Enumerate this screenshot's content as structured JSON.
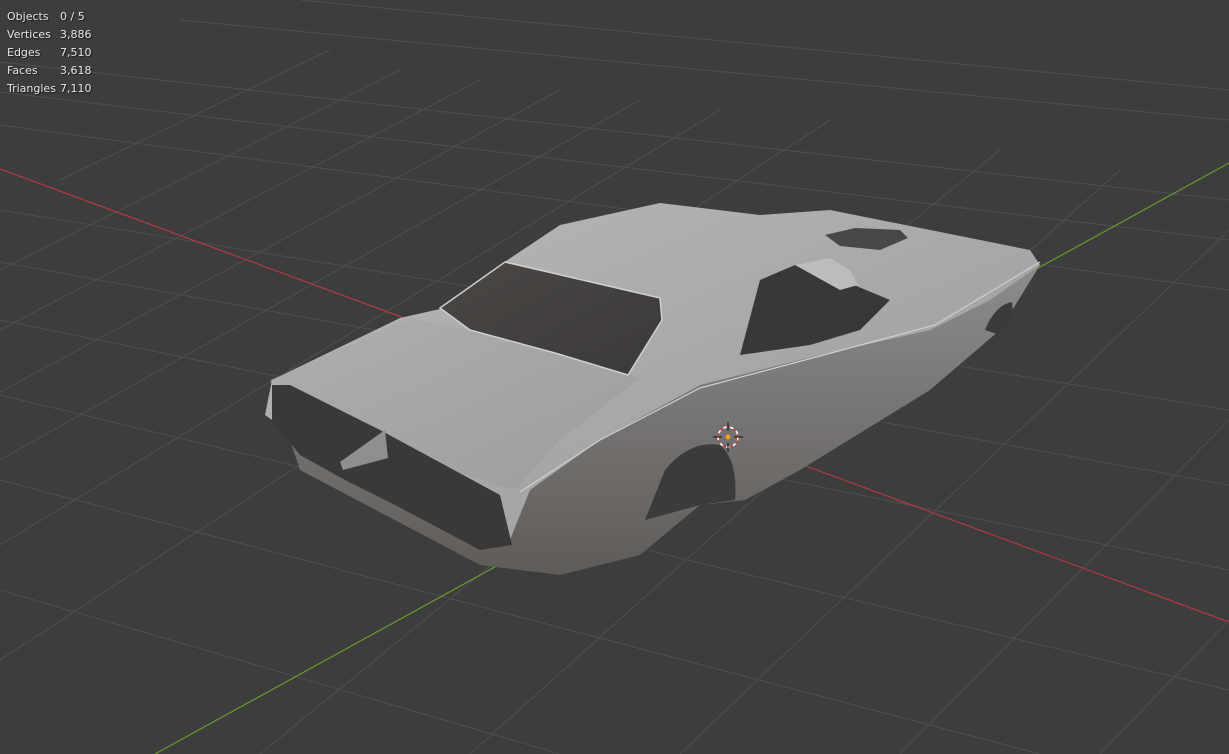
{
  "stats": [
    {
      "label": "Objects",
      "value": "0 / 5"
    },
    {
      "label": "Vertices",
      "value": "3,886"
    },
    {
      "label": "Edges",
      "value": "7,510"
    },
    {
      "label": "Faces",
      "value": "3,618"
    },
    {
      "label": "Triangles",
      "value": "7,110"
    }
  ],
  "colors": {
    "background": "#3d3d3d",
    "grid_line": "#4f4f4f",
    "x_axis": "#b03a44",
    "y_axis": "#6a9a2a",
    "model": "#a9a9a9",
    "cursor": "#d33a3a"
  },
  "icons": {
    "cursor": "3d-cursor-icon"
  }
}
